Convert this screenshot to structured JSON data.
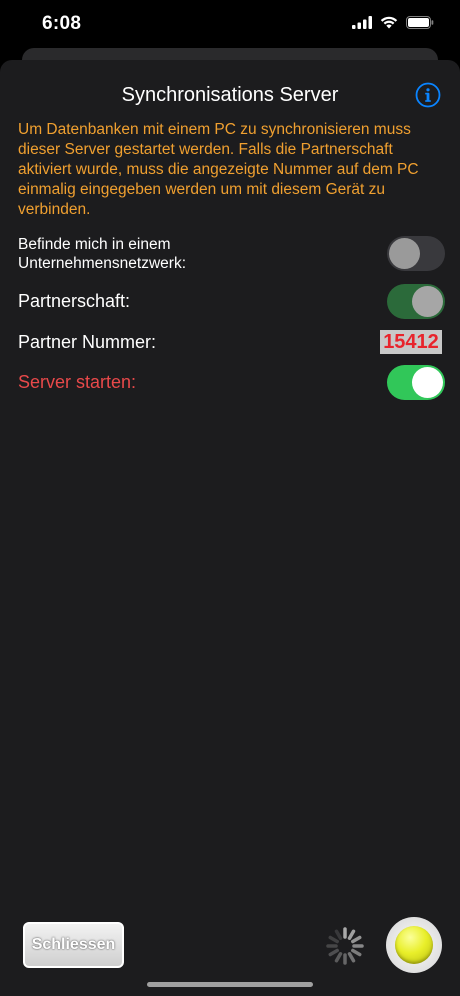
{
  "status_bar": {
    "time": "6:08"
  },
  "header": {
    "title": "Synchronisations Server"
  },
  "description": "Um Datenbanken mit einem PC zu synchronisieren muss dieser Server gestartet werden. Falls die Partnerschaft aktiviert wurde, muss die angezeigte Nummer auf dem PC einmalig eingegeben werden um mit diesem Gerät zu verbinden.",
  "settings": {
    "corporate_network": {
      "label_line1": "Befinde mich in einem",
      "label_line2": "Unternehmensnetzwerk:",
      "enabled": false
    },
    "partnership": {
      "label": "Partnerschaft:",
      "enabled": true
    },
    "partner_number": {
      "label": "Partner Nummer:",
      "value": "15412"
    },
    "server_start": {
      "label": "Server starten:",
      "enabled": true
    }
  },
  "footer": {
    "close_label": "Schliessen"
  },
  "colors": {
    "description_text": "#f0a030",
    "server_label": "#e8494a",
    "toggle_on": "#31c759",
    "partner_number_text": "#e8242c",
    "info_accent": "#0a84ff"
  },
  "icons": {
    "info": "info-circle-icon",
    "status_light": "yellow-status-lamp",
    "loading": "activity-spinner"
  }
}
